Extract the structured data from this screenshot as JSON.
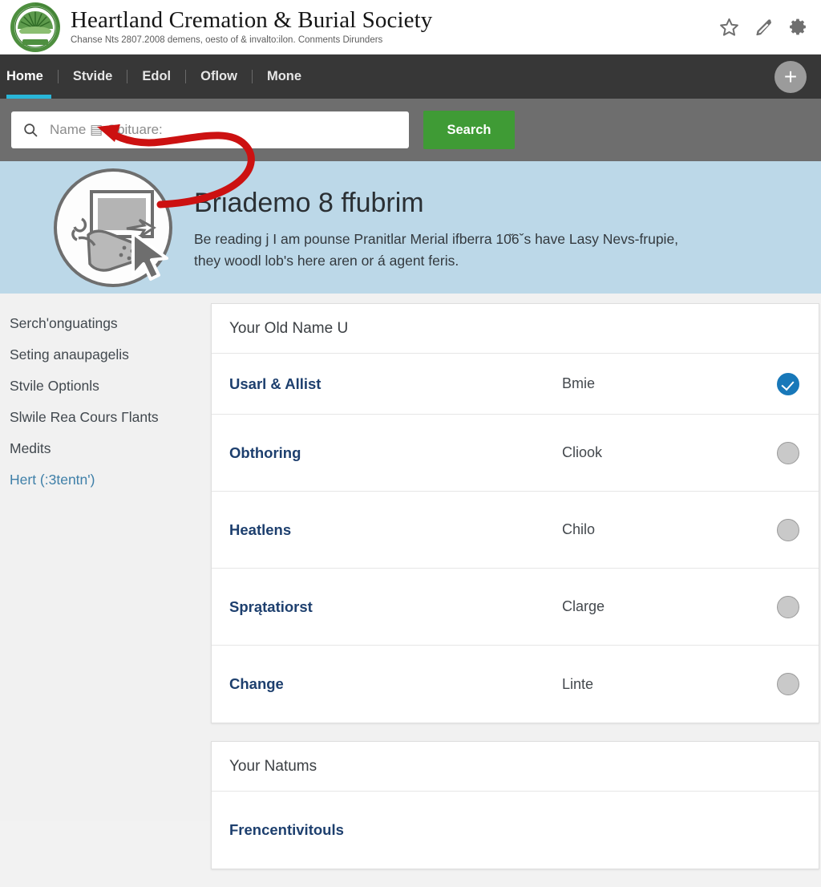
{
  "header": {
    "logo_alt": "heartland-seal-logo",
    "title": "Heartland Cremation & Burial Society",
    "subtitle": "Chanse Nts 2807.2008 demens, oesto of & invalto:ilon. Conments Dirunders",
    "icons": [
      {
        "name": "star-icon",
        "glyph": "star"
      },
      {
        "name": "edit-pencil-icon",
        "glyph": "pencil"
      },
      {
        "name": "gear-icon",
        "glyph": "gear"
      }
    ]
  },
  "nav": {
    "items": [
      {
        "label": "Home",
        "active": true
      },
      {
        "label": "Stvide",
        "active": false
      },
      {
        "label": "Edol",
        "active": false
      },
      {
        "label": "Oflow",
        "active": false
      },
      {
        "label": "Mone",
        "active": false
      }
    ],
    "add_button_label": "+",
    "active_underline_color": "#29b6d8",
    "background_color": "#373737"
  },
  "search": {
    "placeholder": "Name ▤ Obituare:",
    "value": "",
    "icon": "magnifier-icon",
    "button_label": "Search",
    "button_color": "#3f9b35",
    "strip_color": "#6e6e6e"
  },
  "hero": {
    "illustration": "screen-with-cursor-illustration",
    "title": "Briademo 8 ffubrim",
    "body_line1": "Be reading j I am pounse Pranitlar Merial ifberra 10̆6ˇs have Lasy Nevs-frupie,",
    "body_line2": "they woodl lob's here aren or á agent feris.",
    "background_color": "#bcd8e8"
  },
  "sidebar": {
    "items": [
      {
        "label": "Serchʹonguatings",
        "accent": false
      },
      {
        "label": "Seting anaupagelis",
        "accent": false
      },
      {
        "label": "Stvile Optionls",
        "accent": false
      },
      {
        "label": "Slwile Rea Cours Γlants",
        "accent": false
      },
      {
        "label": "Medits",
        "accent": false
      },
      {
        "label": "Hert (:3tentn')",
        "accent": true
      }
    ]
  },
  "main": {
    "cards": [
      {
        "heading": "Your Old Name U",
        "rows": [
          {
            "label": "Usarl & Allist",
            "value": "Bmie",
            "selected": true
          },
          {
            "label": "Obthoring",
            "value": "Cliook",
            "selected": false
          },
          {
            "label": "Heatlens",
            "value": "Chilo",
            "selected": false
          },
          {
            "label": "Sprątatiorst",
            "value": "Clarge",
            "selected": false
          },
          {
            "label": "Change",
            "value": "Linte",
            "selected": false
          }
        ]
      },
      {
        "heading": "Your Natums",
        "rows": [
          {
            "label": "Frencentivitouls",
            "value": "",
            "selected": null
          }
        ]
      }
    ]
  },
  "annotation": {
    "type": "red-curved-arrow",
    "color": "#cc1111",
    "points_to": "search-input"
  }
}
